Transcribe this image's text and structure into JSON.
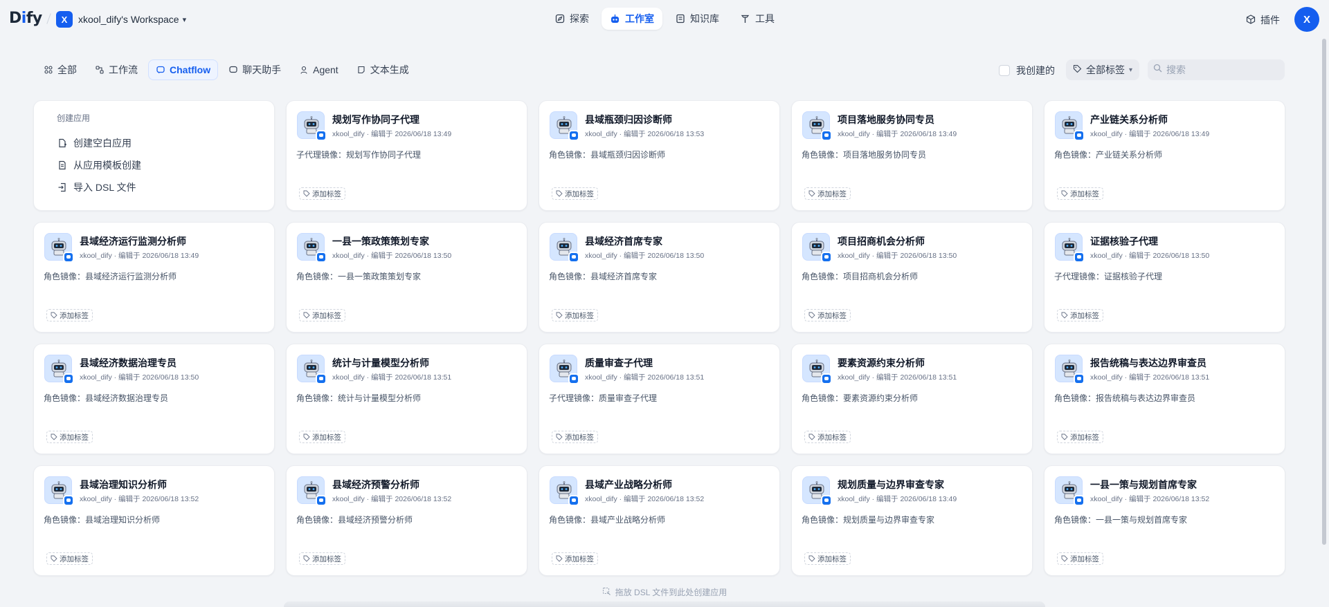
{
  "logo": {
    "part1": "D",
    "part2": "i",
    "part3": "fy"
  },
  "workspace": {
    "avatar": "X",
    "name": "xkool_dify's Workspace"
  },
  "nav": [
    {
      "label": "探索",
      "icon": "compass-icon",
      "active": false
    },
    {
      "label": "工作室",
      "icon": "robot-icon",
      "active": true
    },
    {
      "label": "知识库",
      "icon": "book-icon",
      "active": false
    },
    {
      "label": "工具",
      "icon": "hammer-icon",
      "active": false
    }
  ],
  "plugins_label": "插件",
  "user_avatar": "X",
  "filters": [
    {
      "label": "全部",
      "icon": "grid-icon",
      "active": false
    },
    {
      "label": "工作流",
      "icon": "workflow-icon",
      "active": false
    },
    {
      "label": "Chatflow",
      "icon": "chatflow-icon",
      "active": true
    },
    {
      "label": "聊天助手",
      "icon": "chat-icon",
      "active": false
    },
    {
      "label": "Agent",
      "icon": "agent-icon",
      "active": false
    },
    {
      "label": "文本生成",
      "icon": "text-icon",
      "active": false
    }
  ],
  "mine_label": "我创建的",
  "tag_select_label": "全部标签",
  "search_placeholder": "搜索",
  "create": {
    "title": "创建应用",
    "items": [
      {
        "label": "创建空白应用",
        "icon": "file-plus-icon"
      },
      {
        "label": "从应用模板创建",
        "icon": "template-icon"
      },
      {
        "label": "导入 DSL 文件",
        "icon": "import-icon"
      }
    ]
  },
  "add_tag_label": "添加标签",
  "apps": [
    {
      "name": "规划写作协同子代理",
      "meta": "xkool_dify · 编辑于 2026/06/18 13:49",
      "desc": "子代理镜像：规划写作协同子代理"
    },
    {
      "name": "县域瓶颈归因诊断师",
      "meta": "xkool_dify · 编辑于 2026/06/18 13:53",
      "desc": "角色镜像：县域瓶颈归因诊断师"
    },
    {
      "name": "项目落地服务协同专员",
      "meta": "xkool_dify · 编辑于 2026/06/18 13:49",
      "desc": "角色镜像：项目落地服务协同专员"
    },
    {
      "name": "产业链关系分析师",
      "meta": "xkool_dify · 编辑于 2026/06/18 13:49",
      "desc": "角色镜像：产业链关系分析师"
    },
    {
      "name": "县域经济运行监测分析师",
      "meta": "xkool_dify · 编辑于 2026/06/18 13:49",
      "desc": "角色镜像：县域经济运行监测分析师"
    },
    {
      "name": "一县一策政策策划专家",
      "meta": "xkool_dify · 编辑于 2026/06/18 13:50",
      "desc": "角色镜像：一县一策政策策划专家"
    },
    {
      "name": "县域经济首席专家",
      "meta": "xkool_dify · 编辑于 2026/06/18 13:50",
      "desc": "角色镜像：县域经济首席专家"
    },
    {
      "name": "项目招商机会分析师",
      "meta": "xkool_dify · 编辑于 2026/06/18 13:50",
      "desc": "角色镜像：项目招商机会分析师"
    },
    {
      "name": "证据核验子代理",
      "meta": "xkool_dify · 编辑于 2026/06/18 13:50",
      "desc": "子代理镜像：证据核验子代理"
    },
    {
      "name": "县域经济数据治理专员",
      "meta": "xkool_dify · 编辑于 2026/06/18 13:50",
      "desc": "角色镜像：县域经济数据治理专员"
    },
    {
      "name": "统计与计量模型分析师",
      "meta": "xkool_dify · 编辑于 2026/06/18 13:51",
      "desc": "角色镜像：统计与计量模型分析师"
    },
    {
      "name": "质量审查子代理",
      "meta": "xkool_dify · 编辑于 2026/06/18 13:51",
      "desc": "子代理镜像：质量审查子代理"
    },
    {
      "name": "要素资源约束分析师",
      "meta": "xkool_dify · 编辑于 2026/06/18 13:51",
      "desc": "角色镜像：要素资源约束分析师"
    },
    {
      "name": "报告统稿与表达边界审查员",
      "meta": "xkool_dify · 编辑于 2026/06/18 13:51",
      "desc": "角色镜像：报告统稿与表达边界审查员"
    },
    {
      "name": "县域治理知识分析师",
      "meta": "xkool_dify · 编辑于 2026/06/18 13:52",
      "desc": "角色镜像：县域治理知识分析师"
    },
    {
      "name": "县域经济预警分析师",
      "meta": "xkool_dify · 编辑于 2026/06/18 13:52",
      "desc": "角色镜像：县域经济预警分析师"
    },
    {
      "name": "县域产业战略分析师",
      "meta": "xkool_dify · 编辑于 2026/06/18 13:52",
      "desc": "角色镜像：县域产业战略分析师"
    },
    {
      "name": "规划质量与边界审查专家",
      "meta": "xkool_dify · 编辑于 2026/06/18 13:49",
      "desc": "角色镜像：规划质量与边界审查专家"
    },
    {
      "name": "一县一策与规划首席专家",
      "meta": "xkool_dify · 编辑于 2026/06/18 13:52",
      "desc": "角色镜像：一县一策与规划首席专家"
    }
  ],
  "drop_hint": "拖放 DSL 文件到此处创建应用",
  "colors": {
    "accent": "#155eef",
    "background": "#f2f4f7",
    "card": "#ffffff"
  }
}
